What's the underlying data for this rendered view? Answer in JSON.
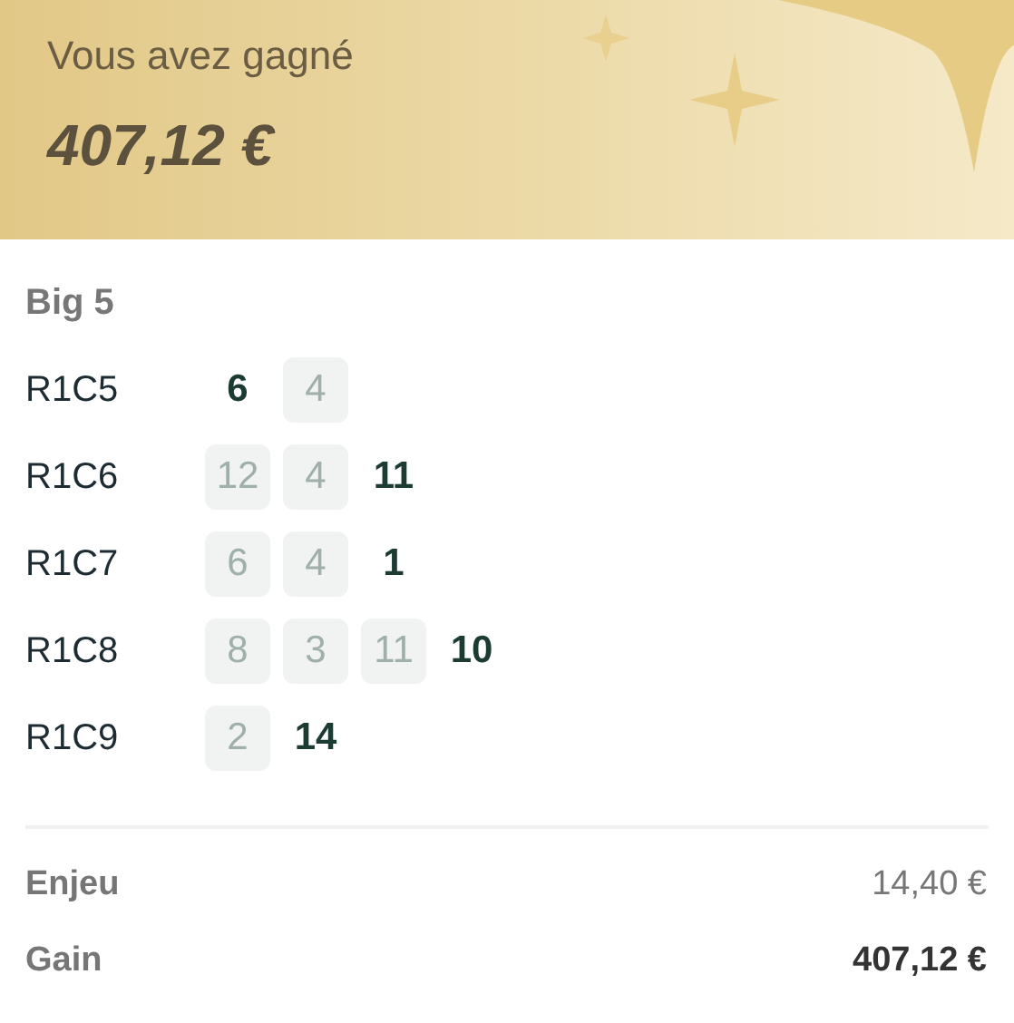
{
  "header": {
    "label": "Vous avez gagné",
    "amount": "407,12 €"
  },
  "game": {
    "title": "Big 5",
    "rows": [
      {
        "label": "R1C5",
        "numbers": [
          {
            "value": "6",
            "hit": true
          },
          {
            "value": "4",
            "hit": false
          }
        ]
      },
      {
        "label": "R1C6",
        "numbers": [
          {
            "value": "12",
            "hit": false
          },
          {
            "value": "4",
            "hit": false
          },
          {
            "value": "11",
            "hit": true
          }
        ]
      },
      {
        "label": "R1C7",
        "numbers": [
          {
            "value": "6",
            "hit": false
          },
          {
            "value": "4",
            "hit": false
          },
          {
            "value": "1",
            "hit": true
          }
        ]
      },
      {
        "label": "R1C8",
        "numbers": [
          {
            "value": "8",
            "hit": false
          },
          {
            "value": "3",
            "hit": false
          },
          {
            "value": "11",
            "hit": false
          },
          {
            "value": "10",
            "hit": true
          }
        ]
      },
      {
        "label": "R1C9",
        "numbers": [
          {
            "value": "2",
            "hit": false
          },
          {
            "value": "14",
            "hit": true
          }
        ]
      }
    ]
  },
  "summary": [
    {
      "label": "Enjeu",
      "value": "14,40 €",
      "kind": "stake"
    },
    {
      "label": "Gain",
      "value": "407,12 €",
      "kind": "win"
    }
  ]
}
